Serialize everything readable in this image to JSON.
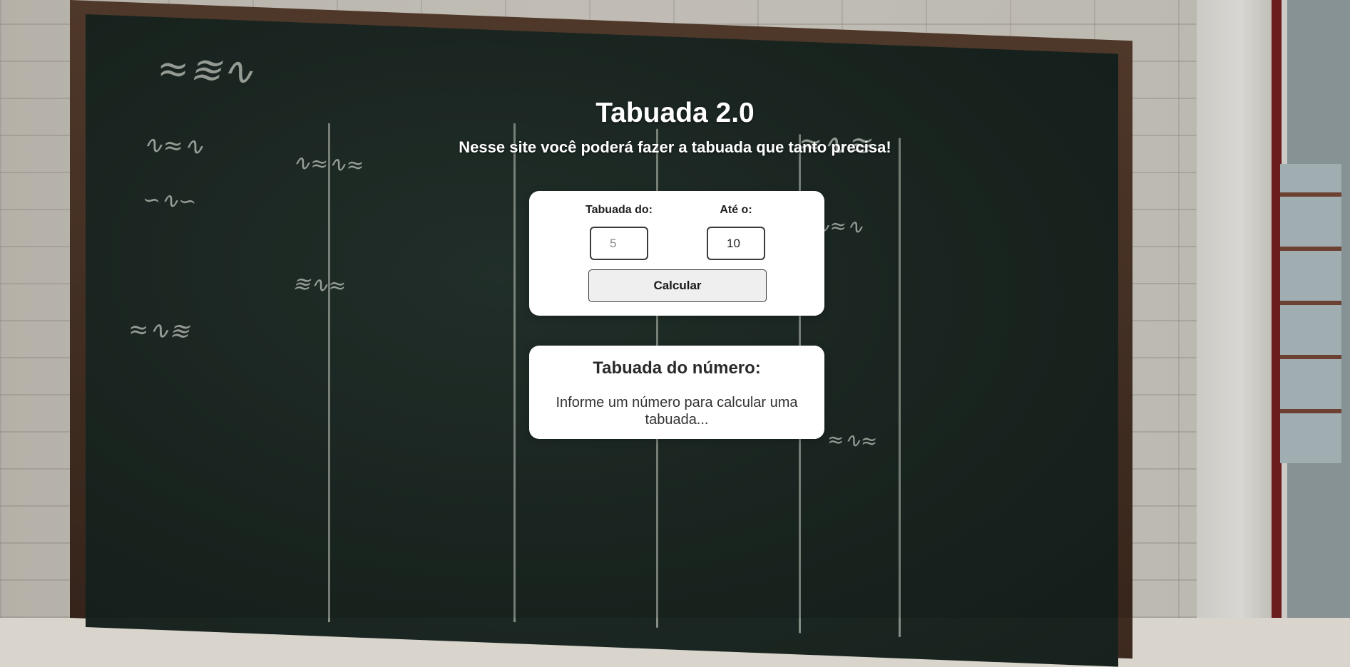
{
  "header": {
    "title": "Tabuada 2.0",
    "subtitle": "Nesse site você poderá fazer a tabuada que tanto precisa!"
  },
  "form": {
    "number_label": "Tabuada do:",
    "number_placeholder": "5",
    "number_value": "",
    "limit_label": "Até o:",
    "limit_value": "10",
    "calculate_label": "Calcular"
  },
  "result": {
    "title": "Tabuada do número:",
    "message": "Informe um número para calcular uma tabuada..."
  },
  "colors": {
    "card_background": "#ffffff",
    "button_background": "#efefef",
    "header_text": "#ffffff"
  }
}
